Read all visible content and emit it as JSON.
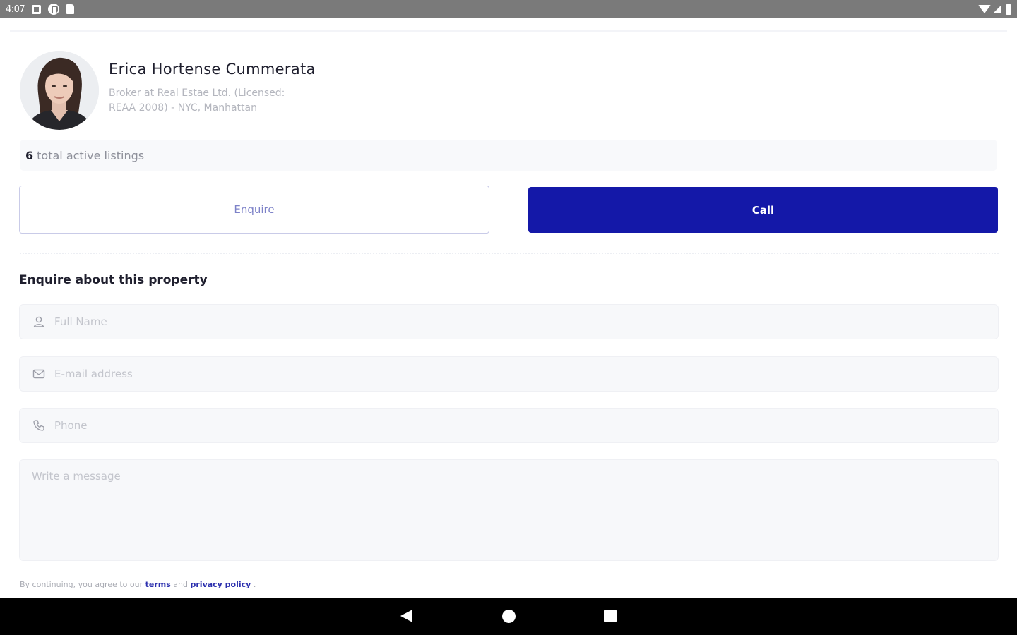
{
  "status_bar": {
    "time": "4:07",
    "icons_left": [
      "notification-icon",
      "pocket-casts-icon",
      "sd-card-icon"
    ],
    "icons_right": [
      "wifi-icon",
      "signal-icon",
      "battery-icon"
    ]
  },
  "agent": {
    "name": "Erica Hortense Cummerata",
    "subtitle": "Broker at Real Estae Ltd. (Licensed: REAA 2008) - NYC, Manhattan",
    "avatar_icon": "agent-photo"
  },
  "listings": {
    "count": "6",
    "label": "total active listings"
  },
  "buttons": {
    "enquire_label": "Enquire",
    "call_label": "Call"
  },
  "form": {
    "title": "Enquire about this property",
    "full_name_placeholder": "Full Name",
    "email_placeholder": "E-mail address",
    "phone_placeholder": "Phone",
    "message_placeholder": "Write a message"
  },
  "terms": {
    "prefix": "By continuing, you agree to our",
    "terms_link": "terms",
    "and": "and",
    "privacy_link": "privacy policy",
    "suffix": "."
  },
  "colors": {
    "primary": "#1418a8",
    "status_bar": "#7a7a7a",
    "nav_bar": "#000000",
    "field_bg": "#f7f8fa"
  }
}
